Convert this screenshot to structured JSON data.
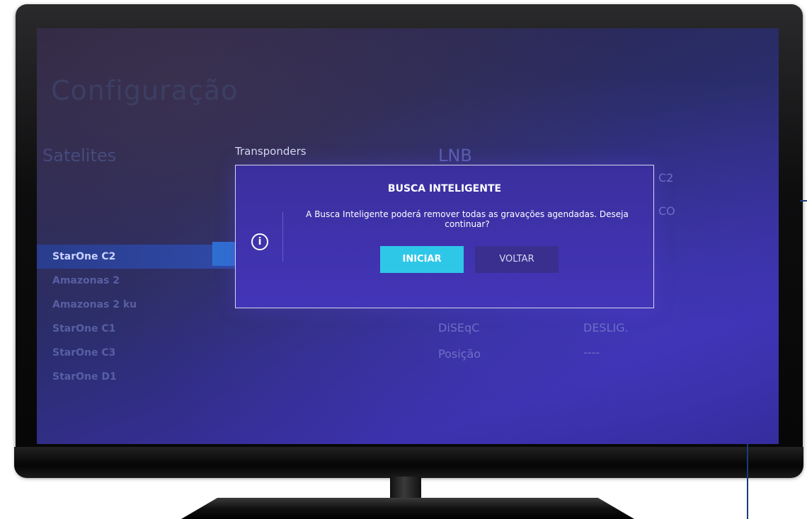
{
  "screen": {
    "page_title": "Configuração",
    "satelites_header": "Satelites",
    "transponders_label": "Transponders",
    "lnb_header": "LNB",
    "satellite_list": [
      {
        "label": "StarOne C2",
        "selected": true
      },
      {
        "label": "Amazonas 2",
        "selected": false
      },
      {
        "label": "Amazonas 2 ku",
        "selected": false
      },
      {
        "label": "StarOne C1",
        "selected": false
      },
      {
        "label": "StarOne C3",
        "selected": false
      },
      {
        "label": "StarOne D1",
        "selected": false
      }
    ],
    "lnb_settings": {
      "value_c2": "C2",
      "value_co": "CO",
      "diseqc_label": "DiSEqC",
      "diseqc_value": "DESLIG.",
      "posicao_label": "Posição",
      "posicao_value": "----"
    }
  },
  "dialog": {
    "title": "BUSCA INTELIGENTE",
    "message": "A Busca Inteligente poderá remover todas as gravações agendadas. Deseja continuar?",
    "icon": "info-icon",
    "confirm_label": "INICIAR",
    "cancel_label": "VOLTAR"
  },
  "colors": {
    "screen_bg": "#2f2890",
    "selected_item": "#2f4aa8",
    "confirm_button": "#2fc7e8",
    "cancel_button": "#3a2f8f",
    "dialog_bg": "#4335b8"
  }
}
